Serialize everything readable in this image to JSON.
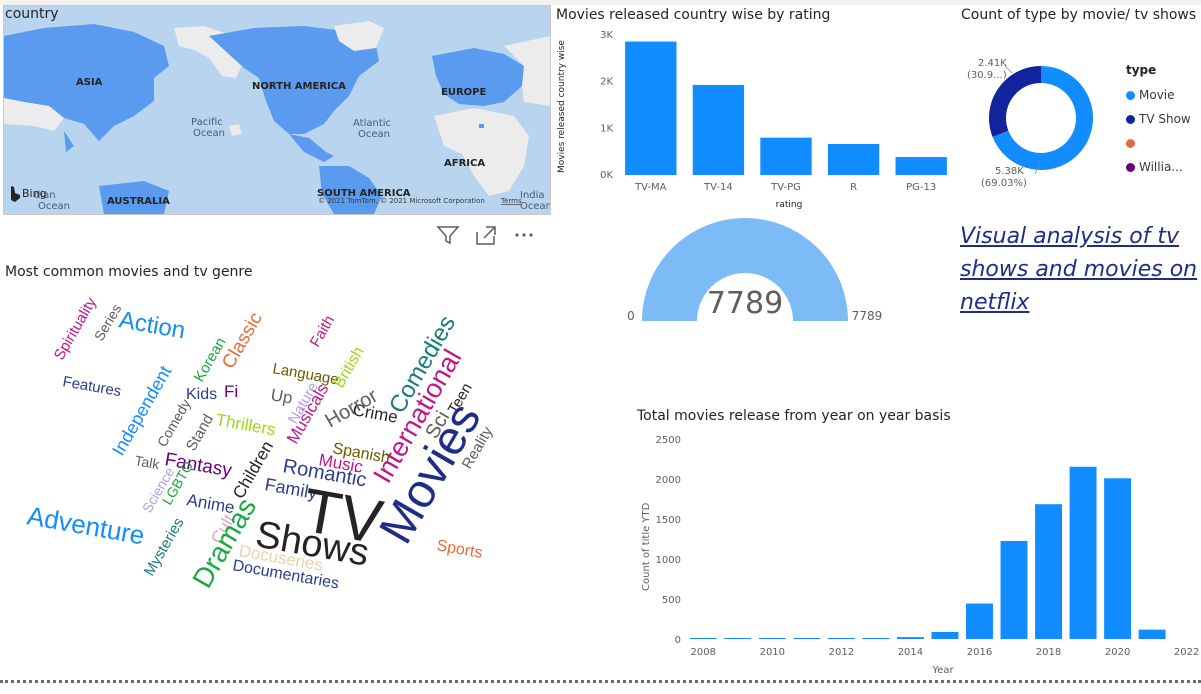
{
  "map": {
    "title": "country",
    "labels": {
      "asia": "ASIA",
      "north_america": "NORTH AMERICA",
      "europe": "EUROPE",
      "africa": "AFRICA",
      "south_america": "SOUTH AMERICA",
      "australia": "AUSTRALIA",
      "pacific": "Pacific\nOcean",
      "atlantic": "Atlantic\nOcean",
      "indian_left": "Indian\nOcean",
      "indian_right": "India\nOcean"
    },
    "bing_label": "Bing",
    "copyright": "© 2021 TomTom, © 2021 Microsoft Corporation",
    "terms": "Terms",
    "colors": {
      "water": "#b8d4ef",
      "land": "#ececec",
      "highlight": "#5a9bef"
    }
  },
  "toolbar_icons": [
    "filter-icon",
    "focus-mode-icon",
    "more-options-icon"
  ],
  "wordcloud": {
    "title": "Most common movies and tv genre",
    "words": [
      "Spirituality",
      "Series",
      "Action",
      "Features",
      "Korean",
      "Classic",
      "Faith",
      "Independent",
      "Comedy",
      "Kids",
      "Fi",
      "Language",
      "British",
      "Comedies",
      "International",
      "Up",
      "Nature",
      "Thrillers",
      "Stand",
      "Musicals",
      "Crime",
      "Horror",
      "Sci",
      "Teen",
      "Spanish",
      "Music",
      "Reality",
      "Talk",
      "Fantasy",
      "Romantic",
      "Children",
      "Family",
      "Science",
      "LGBTQ",
      "Anime",
      "TV",
      "Movies",
      "Adventure",
      "Cult",
      "Dramas",
      "Shows",
      "Docuseries",
      "Mysteries",
      "Documentaries",
      "Sports"
    ]
  },
  "gauge": {
    "value": "7789",
    "min": "0",
    "max": "7789",
    "color": "#7dbbf7"
  },
  "story": {
    "text": "Visual analysis of tv shows and movies on netflix"
  },
  "donut": {
    "title": "Count of type by movie/ tv shows",
    "top_label": "2.41K",
    "top_sub": "(30.9...)",
    "bottom_label": "5.38K",
    "bottom_sub": "(69.03%)"
  },
  "chart_data": [
    {
      "type": "bar",
      "title": "Movies released country wise by rating",
      "xlabel": "rating",
      "ylabel": "Movies released country wise",
      "categories": [
        "TV-MA",
        "TV-14",
        "TV-PG",
        "R",
        "PG-13"
      ],
      "values": [
        2860,
        1930,
        800,
        665,
        385
      ],
      "yticks": [
        "0K",
        "1K",
        "2K",
        "3K"
      ],
      "ylim": [
        0,
        3000
      ],
      "color": "#118dff"
    },
    {
      "type": "pie",
      "title": "Count of type by movie/ tv shows",
      "legend_title": "type",
      "categories": [
        "Movie",
        "TV Show",
        "",
        "Willia..."
      ],
      "values": [
        5377,
        2410,
        1,
        1
      ],
      "colors": [
        "#118dff",
        "#12239e",
        "#e66c37",
        "#6b007b"
      ],
      "legend": "right"
    },
    {
      "type": "bar",
      "title": "Total movies release from year on year basis",
      "xlabel": "Year",
      "ylabel": "Count of title YTD",
      "x": [
        2008,
        2009,
        2010,
        2011,
        2012,
        2013,
        2014,
        2015,
        2016,
        2017,
        2018,
        2019,
        2020,
        2021
      ],
      "values": [
        2,
        2,
        2,
        3,
        3,
        5,
        24,
        88,
        443,
        1225,
        1685,
        2153,
        2009,
        117
      ],
      "xticks": [
        "2008",
        "2010",
        "2012",
        "2014",
        "2016",
        "2018",
        "2020",
        "2022"
      ],
      "yticks": [
        "0",
        "500",
        "1000",
        "1500",
        "2000",
        "2500"
      ],
      "ylim": [
        0,
        2500
      ],
      "color": "#118dff"
    }
  ]
}
